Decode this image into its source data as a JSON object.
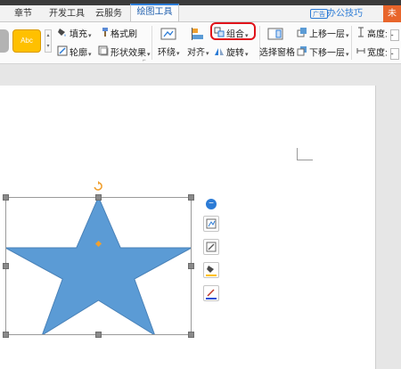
{
  "tabs": {
    "chapter": "章节",
    "developer": "开发工具",
    "cloud": "云服务",
    "drawing_tools": "绘图工具"
  },
  "tabbar_right": {
    "ad_badge": "广告",
    "office_tips": "办公技巧",
    "corner_label": "未"
  },
  "ribbon": {
    "style_preview": "Abc",
    "fill": "填充",
    "format_painter": "格式刷",
    "outline": "轮廓",
    "shape_effects": "形状效果",
    "wrap": "环绕",
    "align": "对齐",
    "group": "组合",
    "rotate": "旋转",
    "selection_pane": "选择窗格",
    "bring_forward": "上移一层",
    "send_backward": "下移一层",
    "height_label": "高度:",
    "width_label": "宽度:"
  },
  "colors": {
    "accent": "#2b7bd6",
    "star_fill": "#5b9bd5",
    "highlight": "#e0131a",
    "style_orange": "#ffc000"
  }
}
